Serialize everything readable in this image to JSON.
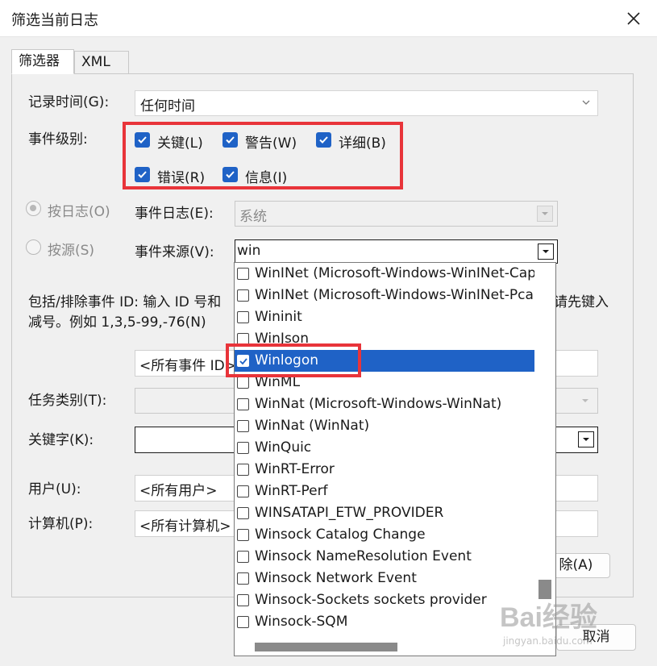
{
  "window": {
    "title": "筛选当前日志"
  },
  "tabs": [
    {
      "label": "筛选器"
    },
    {
      "label": "XML"
    }
  ],
  "logged": {
    "label": "记录时间(G):",
    "value": "任何时间"
  },
  "event_level": {
    "label": "事件级别:",
    "items": [
      {
        "label": "关键(L)",
        "checked": true
      },
      {
        "label": "警告(W)",
        "checked": true
      },
      {
        "label": "详细(B)",
        "checked": true
      },
      {
        "label": "错误(R)",
        "checked": true
      },
      {
        "label": "信息(I)",
        "checked": true
      }
    ]
  },
  "by_log": {
    "radio_label": "按日志(O)",
    "field_label": "事件日志(E):",
    "value": "系统"
  },
  "by_source": {
    "radio_label": "按源(S)",
    "field_label": "事件来源(V):",
    "value": "win"
  },
  "event_ids": {
    "desc_line1_left": "包括/排除事件 ID: 输入 ID 号和",
    "desc_line1_right": "请先键入",
    "desc_line2": "减号。例如 1,3,5-99,-76(N)",
    "placeholder": "<所有事件 ID>"
  },
  "task_category": {
    "label": "任务类别(T):"
  },
  "keywords": {
    "label": "关键字(K):"
  },
  "user": {
    "label": "用户(U):",
    "value": "<所有用户>"
  },
  "computer": {
    "label": "计算机(P):",
    "value": "<所有计算机>"
  },
  "buttons": {
    "clear": "除(A)",
    "cancel": "取消"
  },
  "source_list": [
    {
      "label": "WinINet (Microsoft-Windows-WinINet-Capt",
      "checked": false,
      "selected": false
    },
    {
      "label": "WinINet (Microsoft-Windows-WinINet-Pca)",
      "checked": false,
      "selected": false
    },
    {
      "label": "Wininit",
      "checked": false,
      "selected": false
    },
    {
      "label": "WinJson",
      "checked": false,
      "selected": false
    },
    {
      "label": "Winlogon",
      "checked": true,
      "selected": true
    },
    {
      "label": "WinML",
      "checked": false,
      "selected": false
    },
    {
      "label": "WinNat (Microsoft-Windows-WinNat)",
      "checked": false,
      "selected": false
    },
    {
      "label": "WinNat (WinNat)",
      "checked": false,
      "selected": false
    },
    {
      "label": "WinQuic",
      "checked": false,
      "selected": false
    },
    {
      "label": "WinRT-Error",
      "checked": false,
      "selected": false
    },
    {
      "label": "WinRT-Perf",
      "checked": false,
      "selected": false
    },
    {
      "label": "WINSATAPI_ETW_PROVIDER",
      "checked": false,
      "selected": false
    },
    {
      "label": "Winsock Catalog Change",
      "checked": false,
      "selected": false
    },
    {
      "label": "Winsock NameResolution Event",
      "checked": false,
      "selected": false
    },
    {
      "label": "Winsock Network Event",
      "checked": false,
      "selected": false
    },
    {
      "label": "Winsock-Sockets sockets provider",
      "checked": false,
      "selected": false
    },
    {
      "label": "Winsock-SQM",
      "checked": false,
      "selected": false
    }
  ],
  "watermark": {
    "line1": "Bai经验",
    "line2": "jingyan.baidu.com"
  },
  "colors": {
    "accent": "#1f62c6",
    "highlight_box": "#e8343a"
  }
}
